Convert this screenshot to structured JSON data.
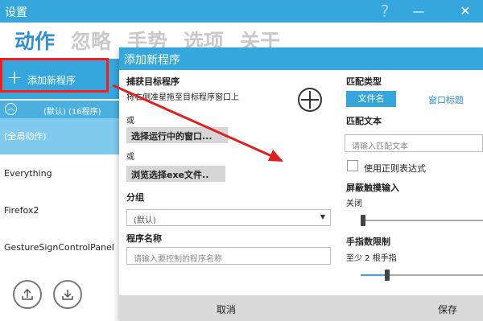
{
  "window": {
    "title": "设置"
  },
  "nav": {
    "tabs": [
      "动作",
      "忽略",
      "手势",
      "选项",
      "关于"
    ]
  },
  "sidebar": {
    "add_label": "添加新程序",
    "group_label": "(默认) (16程序)",
    "items": [
      "(全局动作)",
      "Everything",
      "Firefox2",
      "GestureSignControlPanel"
    ]
  },
  "dialog": {
    "title": "添加新程序",
    "capture": {
      "title": "捕获目标程序",
      "hint": "将右侧准星拖至目标程序窗口上"
    },
    "or1": "或",
    "select_running": "选择运行中的窗口...",
    "or2": "或",
    "browse_exe": "浏览选择exe文件..",
    "group": {
      "label": "分组",
      "value": "(默认)"
    },
    "program_name": {
      "label": "程序名称",
      "placeholder": "请输入要控制的程序名称"
    },
    "match_type": {
      "label": "匹配类型",
      "active": "文件名",
      "other": "窗口标题"
    },
    "match_text": {
      "label": "匹配文本",
      "placeholder": "请输入匹配文本"
    },
    "regex": {
      "label": "使用正则表达式",
      "checked": false
    },
    "block_touch": {
      "label": "屏蔽触摸输入",
      "value_text": "关闭",
      "level": 0
    },
    "finger_limit": {
      "label": "手指数限制",
      "value_text": "至少 2 根手指",
      "level": 0.2
    },
    "cancel": "取消",
    "save": "保存"
  },
  "colors": {
    "accent": "#35a7dc",
    "highlight_red": "#ff1a1a"
  }
}
